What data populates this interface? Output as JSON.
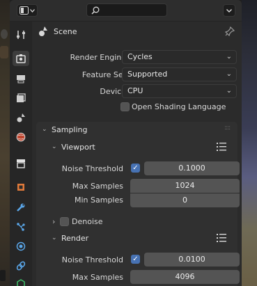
{
  "header": {
    "editor_type_icon": "properties-editor-icon",
    "search_placeholder": "",
    "menu_icon": "chevron-down-icon"
  },
  "context": {
    "icon": "scene-icon",
    "title": "Scene",
    "pin_icon": "pin-icon"
  },
  "tabs": [
    {
      "name": "tool",
      "icon": "tool-icon",
      "active": false
    },
    {
      "name": "render",
      "icon": "render-icon",
      "active": true
    },
    {
      "name": "output",
      "icon": "output-icon",
      "active": false
    },
    {
      "name": "view-layer",
      "icon": "view-layer-icon",
      "active": false
    },
    {
      "name": "scene",
      "icon": "scene-icon",
      "active": false
    },
    {
      "name": "world",
      "icon": "world-icon",
      "active": false
    },
    {
      "name": "collection",
      "icon": "collection-icon",
      "active": false
    },
    {
      "name": "object",
      "icon": "object-icon",
      "active": false
    },
    {
      "name": "modifiers",
      "icon": "wrench-icon",
      "active": false
    },
    {
      "name": "particles",
      "icon": "particles-icon",
      "active": false
    },
    {
      "name": "physics",
      "icon": "physics-icon",
      "active": false
    },
    {
      "name": "constraints",
      "icon": "constraints-icon",
      "active": false
    },
    {
      "name": "data",
      "icon": "data-icon",
      "active": false
    }
  ],
  "render": {
    "engine_label": "Render Engine",
    "engine_value": "Cycles",
    "feature_label": "Feature Set",
    "feature_value": "Supported",
    "device_label": "Device",
    "device_value": "CPU",
    "osl_label": "Open Shading Language",
    "osl_checked": false
  },
  "sampling": {
    "title": "Sampling",
    "viewport": {
      "title": "Viewport",
      "noise_threshold_label": "Noise Threshold",
      "noise_threshold_checked": true,
      "noise_threshold_value": "0.1000",
      "max_samples_label": "Max Samples",
      "max_samples_value": "1024",
      "min_samples_label": "Min Samples",
      "min_samples_value": "0",
      "denoise_label": "Denoise",
      "denoise_checked": false
    },
    "render": {
      "title": "Render",
      "noise_threshold_label": "Noise Threshold",
      "noise_threshold_checked": true,
      "noise_threshold_value": "0.0100",
      "max_samples_label": "Max Samples",
      "max_samples_value": "4096"
    }
  },
  "colors": {
    "accent": "#4772b3",
    "panel": "#2b2b2b",
    "field": "#545454"
  }
}
